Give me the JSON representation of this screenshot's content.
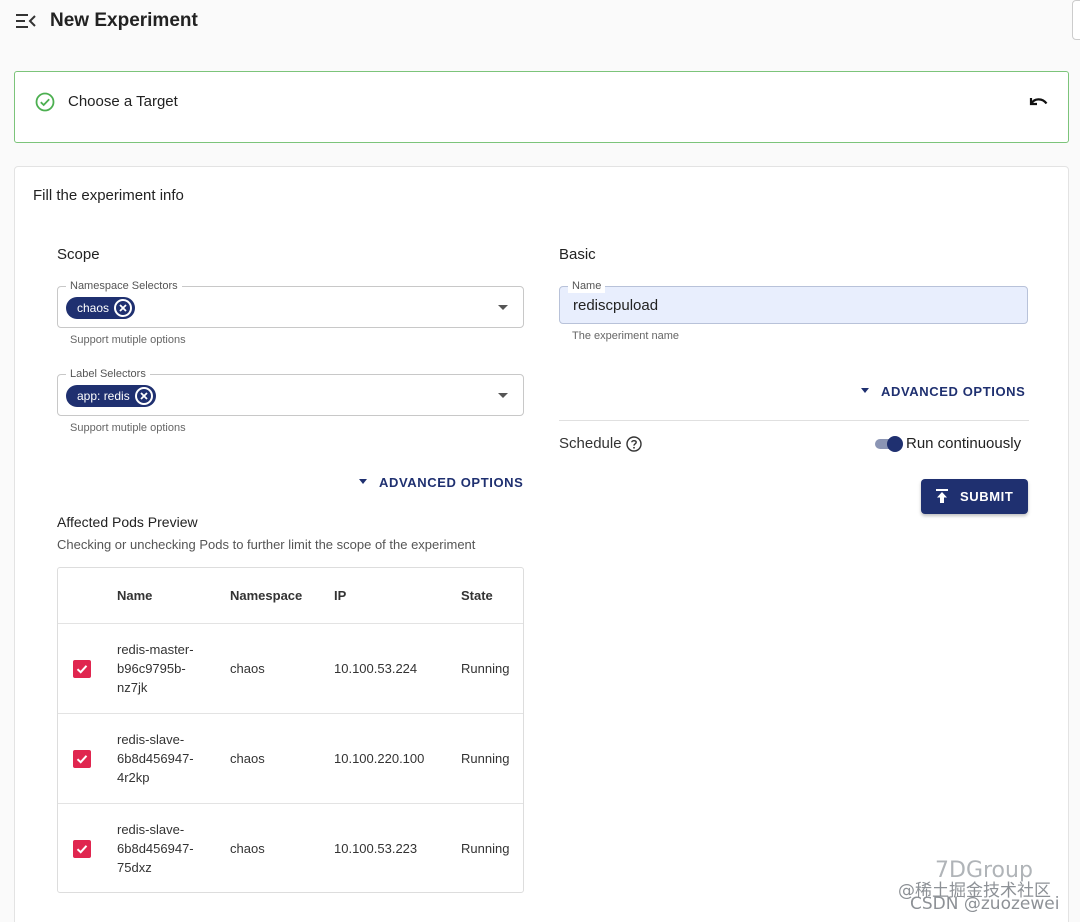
{
  "header": {
    "title": "New Experiment"
  },
  "step": {
    "label": "Choose a Target",
    "status_color": "#4caf50"
  },
  "panel": {
    "title": "Fill the experiment info"
  },
  "scope": {
    "title": "Scope",
    "namespace_selectors": {
      "label": "Namespace Selectors",
      "chips": [
        "chaos"
      ],
      "helper": "Support mutiple options"
    },
    "label_selectors": {
      "label": "Label Selectors",
      "chips": [
        "app: redis"
      ],
      "helper": "Support mutiple options"
    },
    "advanced_options": "ADVANCED OPTIONS"
  },
  "pods_preview": {
    "title": "Affected Pods Preview",
    "description": "Checking or unchecking Pods to further limit the scope of the experiment",
    "columns": [
      "Name",
      "Namespace",
      "IP",
      "State"
    ],
    "rows": [
      {
        "checked": true,
        "name": "redis-master-\nb96c9795b-\nnz7jk",
        "namespace": "chaos",
        "ip": "10.100.53.224",
        "state": "Running"
      },
      {
        "checked": true,
        "name": "redis-slave-\n6b8d456947-\n4r2kp",
        "namespace": "chaos",
        "ip": "10.100.220.100",
        "state": "Running"
      },
      {
        "checked": true,
        "name": "redis-slave-\n6b8d456947-\n75dxz",
        "namespace": "chaos",
        "ip": "10.100.53.223",
        "state": "Running"
      }
    ]
  },
  "basic": {
    "title": "Basic",
    "name_field": {
      "label": "Name",
      "value": "rediscpuload",
      "helper": "The experiment name"
    },
    "advanced_options": "ADVANCED OPTIONS",
    "schedule_label": "Schedule",
    "toggle_label": "Run continuously",
    "toggle_on": true,
    "submit_label": "SUBMIT"
  },
  "colors": {
    "primary": "#1f3070",
    "checkbox": "#e0264f",
    "success_border": "#7cc47a"
  },
  "watermarks": [
    "7DGroup",
    "@稀土掘金技术社区",
    "CSDN @zuozewei"
  ]
}
